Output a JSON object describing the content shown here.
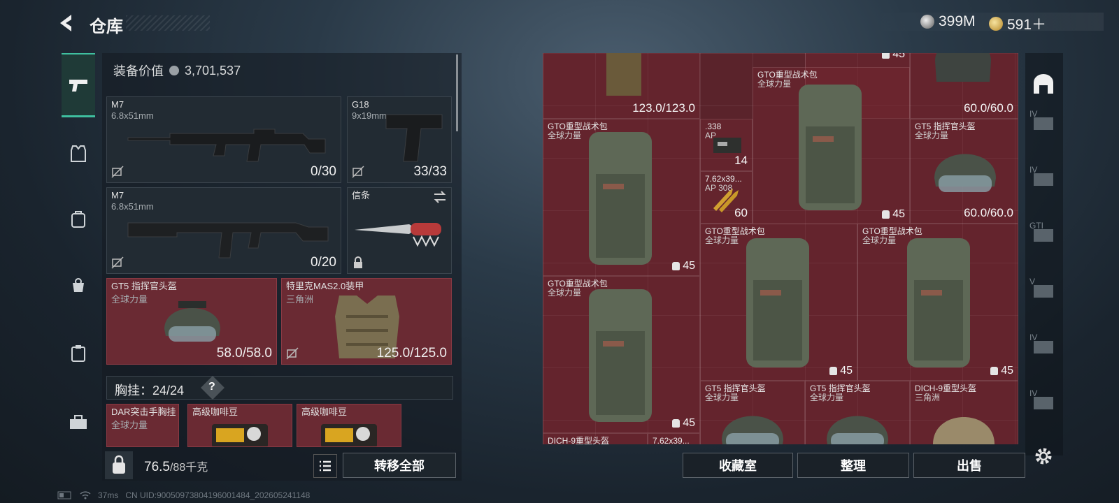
{
  "header": {
    "title": "仓库"
  },
  "currencies": [
    {
      "icon": "silver-coin-icon",
      "value": "399M"
    },
    {
      "icon": "gold-coin-icon",
      "value": "591＋"
    }
  ],
  "loadout": {
    "value_label": "装备价值",
    "value": "3,701,537",
    "slots": [
      {
        "name": "M7",
        "sub": "6.8x51mm",
        "qty": "0/30"
      },
      {
        "name": "G18",
        "sub": "9x19mm",
        "qty": "33/33"
      },
      {
        "name": "M7",
        "sub": "6.8x51mm",
        "qty": "0/20"
      },
      {
        "name": "信条",
        "sub": "",
        "qty": ""
      },
      {
        "name": "GT5 指挥官头盔",
        "sub": "全球力量",
        "qty": "58.0/58.0"
      },
      {
        "name": "特里克MAS2.0装甲",
        "sub": "三角洲",
        "qty": "125.0/125.0"
      }
    ],
    "chest_label": "胸挂：",
    "chest_value": "24/24",
    "chest_help": "?",
    "chest_items": [
      {
        "name": "DAR突击手胸挂",
        "sub": "全球力量"
      },
      {
        "name": "高级咖啡豆",
        "sub": ""
      },
      {
        "name": "高级咖啡豆",
        "sub": ""
      }
    ],
    "weight_value": "76.5",
    "weight_max": "/88千克",
    "transfer_label": "转移全部"
  },
  "status": {
    "ping": "37ms",
    "uid": "CN UID:9005097380419600148​4_202605241148"
  },
  "stash": {
    "items": [
      {
        "name": "",
        "sub": "",
        "value": "123.0/123.0"
      },
      {
        "name": "",
        "sub": "",
        "value": "45"
      },
      {
        "name": "",
        "sub": "",
        "value": "60.0/60.0"
      },
      {
        "name": "GTO重型战术包",
        "sub": "全球力量",
        "value": "45"
      },
      {
        "name": "GTO重型战术包",
        "sub": "全球力量",
        "value": "45"
      },
      {
        "name": ".338",
        "sub": "AP",
        "value": "14"
      },
      {
        "name": "7.62x39...",
        "sub": "AP 308",
        "value": "60"
      },
      {
        "name": "GT5 指挥官头盔",
        "sub": "全球力量",
        "value": "60.0/60.0"
      },
      {
        "name": "GTO重型战术包",
        "sub": "全球力量",
        "value": "45"
      },
      {
        "name": "GTO重型战术包",
        "sub": "全球力量",
        "value": "45"
      },
      {
        "name": "GTO重型战术包",
        "sub": "全球力量",
        "value": "45"
      },
      {
        "name": "GT5 指挥官头盔",
        "sub": "全球力量",
        "value": ""
      },
      {
        "name": "GT5 指挥官头盔",
        "sub": "全球力量",
        "value": ""
      },
      {
        "name": "DICH-9重型头盔",
        "sub": "三角洲",
        "value": ""
      },
      {
        "name": "DICH-9重型头盔",
        "sub": "",
        "value": ""
      },
      {
        "name": "7.62x39...",
        "sub": "",
        "value": ""
      }
    ],
    "side_tags": [
      "IV",
      "IV",
      "GTI",
      "V",
      "IV",
      "IV"
    ],
    "buttons": {
      "collection": "收藏室",
      "sort": "整理",
      "sell": "出售"
    }
  },
  "colors": {
    "accent": "#3fbf9f",
    "slot_red": "#6a2a33",
    "stash_bg": "#5a232b"
  }
}
